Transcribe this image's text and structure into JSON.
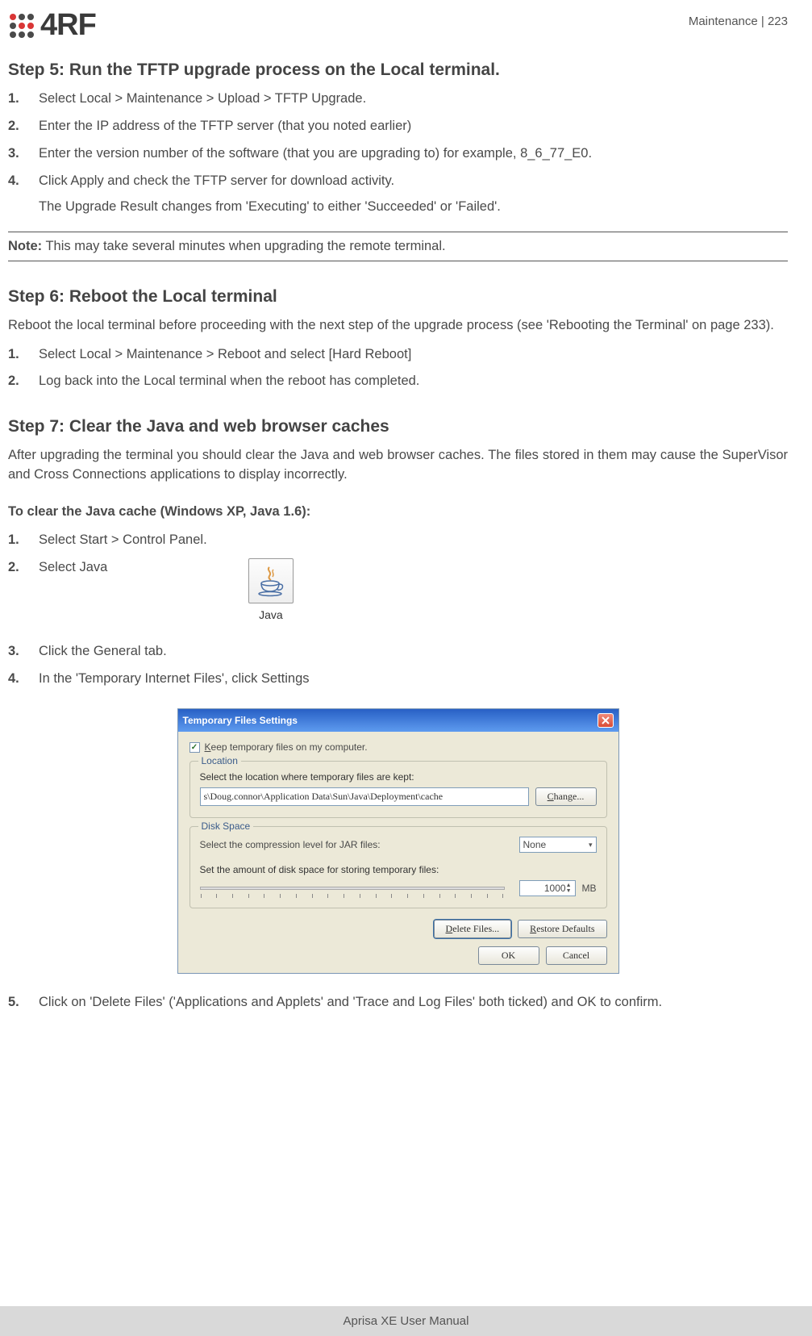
{
  "header": {
    "logo_text": "4RF",
    "page_label": "Maintenance  |  223"
  },
  "step5": {
    "heading": "Step 5: Run the TFTP upgrade process on the Local terminal.",
    "items": [
      "Select Local > Maintenance > Upload > TFTP Upgrade.",
      "Enter the IP address of the TFTP server (that you noted earlier)",
      "Enter the version number of the software (that you are upgrading to) for example, 8_6_77_E0.",
      "Click Apply and check the TFTP server for download activity."
    ],
    "item4_extra": "The Upgrade Result changes from 'Executing' to either 'Succeeded' or 'Failed'.",
    "note_prefix": "Note:",
    "note_text": " This may take several minutes when upgrading the remote terminal."
  },
  "step6": {
    "heading": "Step 6: Reboot the Local terminal",
    "intro": "Reboot the local terminal before proceeding with the next step of the upgrade process (see 'Rebooting the Terminal' on page 233).",
    "items": [
      "Select Local > Maintenance > Reboot and select [Hard Reboot]",
      "Log back into the Local terminal when the reboot has completed."
    ]
  },
  "step7": {
    "heading": "Step 7: Clear the Java and web browser caches",
    "intro": "After upgrading the terminal you should clear the Java and web browser caches. The files stored in them may cause the SuperVisor and Cross Connections applications to display incorrectly.",
    "subhead": "To clear the Java cache (Windows XP, Java 1.6):",
    "item1": "Select Start > Control Panel.",
    "item2": "Select Java",
    "java_label": "Java",
    "item3": "Click the General tab.",
    "item4": "In the 'Temporary Internet Files', click Settings",
    "item5": "Click on 'Delete Files' ('Applications and Applets' and 'Trace and Log Files' both ticked) and OK to confirm."
  },
  "dialog": {
    "title": "Temporary Files Settings",
    "keep_label": "Keep temporary files on my computer.",
    "location_legend": "Location",
    "location_label": "Select the location where temporary files are kept:",
    "location_value": "s\\Doug.connor\\Application Data\\Sun\\Java\\Deployment\\cache",
    "change_btn": "Change...",
    "disk_legend": "Disk Space",
    "compression_label": "Select the compression level for JAR files:",
    "compression_value": "None",
    "amount_label": "Set the amount of disk space for storing temporary files:",
    "amount_value": "1000",
    "amount_unit": "MB",
    "delete_btn": "Delete Files...",
    "restore_btn": "Restore Defaults",
    "ok_btn": "OK",
    "cancel_btn": "Cancel"
  },
  "footer": "Aprisa XE User Manual"
}
